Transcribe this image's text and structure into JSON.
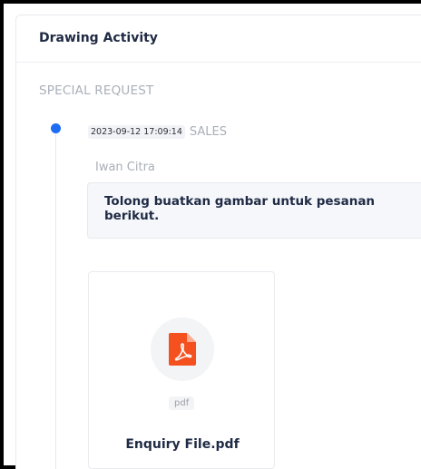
{
  "card": {
    "title": "Drawing Activity"
  },
  "section": {
    "label": "SPECIAL REQUEST"
  },
  "activity": {
    "timestamp": "2023-09-12 17:09:14",
    "role": "SALES",
    "author": "Iwan Citra",
    "message": "Tolong buatkan gambar untuk pesanan berikut."
  },
  "attachment": {
    "type": "pdf",
    "name": "Enquiry File.pdf",
    "icon": "pdf-file-icon"
  },
  "colors": {
    "accent": "#1e6cf3",
    "pdf": "#f4511e",
    "title": "#1f2a44",
    "muted": "#aab0b9"
  }
}
